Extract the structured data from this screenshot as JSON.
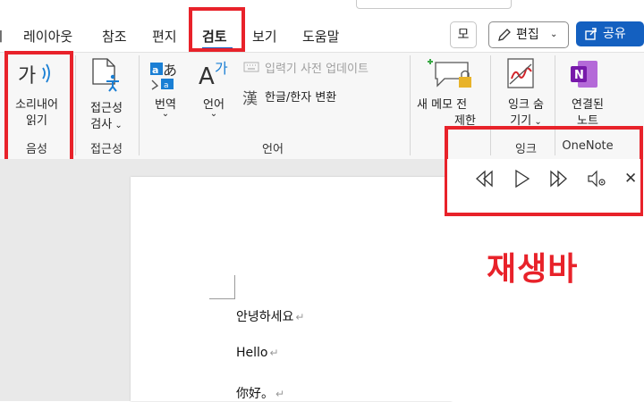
{
  "tabs": [
    {
      "label": "레이아웃"
    },
    {
      "label": "참조"
    },
    {
      "label": "편지"
    },
    {
      "label": "검토"
    },
    {
      "label": "보기"
    },
    {
      "label": "도움말"
    }
  ],
  "header_buttons": {
    "mode_label": "모",
    "edit_label": "편집",
    "share_label": "공유"
  },
  "ribbon": {
    "read_aloud": {
      "line1": "소리내어",
      "line2": "읽기",
      "group": "음성"
    },
    "accessibility": {
      "line1": "접근성",
      "line2": "검사",
      "group": "접근성"
    },
    "translate": {
      "label": "번역"
    },
    "language": {
      "label": "언어"
    },
    "ime_update": {
      "label": "입력기 사전 업데이트"
    },
    "hanja": {
      "label": "한글/한자 변환"
    },
    "language_group": {
      "label": "언어"
    },
    "new_memo": {
      "line1": "새 메",
      "line2": "모",
      "extra1": "전",
      "extra2": "제한"
    },
    "ink": {
      "line1": "잉크 숨",
      "line2": "기기",
      "group": "잉크"
    },
    "onenote": {
      "line1": "연결된",
      "line2": "노트",
      "group": "OneNote"
    }
  },
  "document": {
    "lines": [
      "안녕하세요",
      "Hello",
      "你好。"
    ]
  },
  "annotation": {
    "label": "재생바"
  },
  "colors": {
    "accent_red": "#e8222a",
    "share_blue": "#1460c0",
    "tab_underline": "#185abd"
  }
}
